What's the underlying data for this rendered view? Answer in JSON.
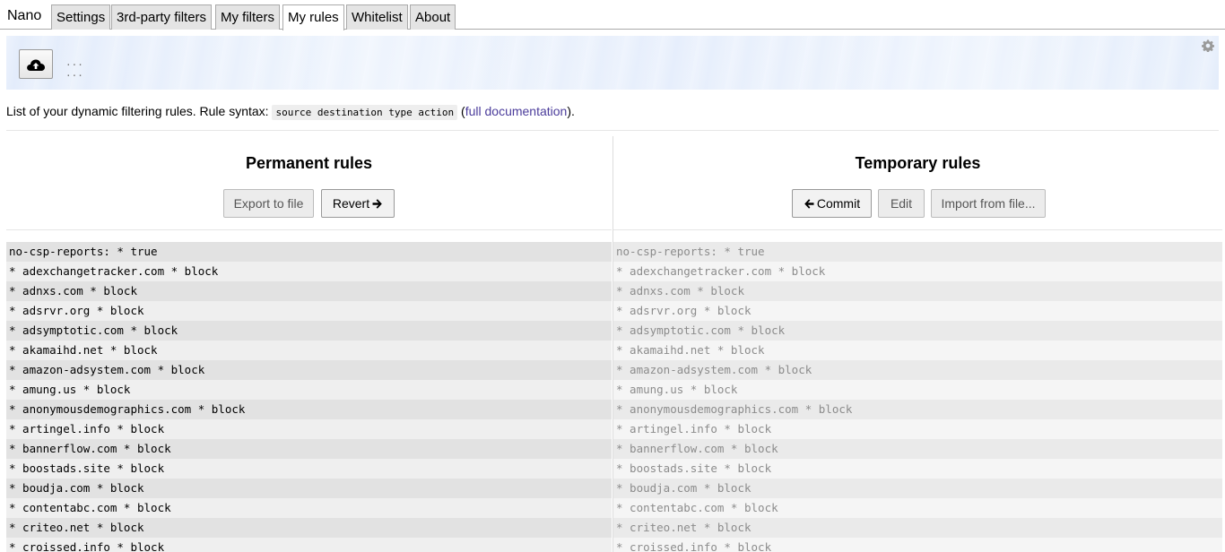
{
  "brand": "Nano",
  "tabs": [
    {
      "label": "Settings",
      "active": false
    },
    {
      "label": "3rd-party filters",
      "active": false
    },
    {
      "label": "My filters",
      "active": false
    },
    {
      "label": "My rules",
      "active": true
    },
    {
      "label": "Whitelist",
      "active": false
    },
    {
      "label": "About",
      "active": false
    }
  ],
  "cloud": {
    "icon": "cloud-upload-icon",
    "line1": "...",
    "line2": "...",
    "settings_icon": "gear-icon"
  },
  "description": {
    "text_before": "List of your dynamic filtering rules. Rule syntax: ",
    "syntax": "source destination type action",
    "paren_open": " (",
    "link_text": "full documentation",
    "paren_close": ")."
  },
  "permanent": {
    "title": "Permanent rules",
    "export_label": "Export to file",
    "revert_label": "Revert",
    "revert_icon": "arrow-right-icon"
  },
  "temporary": {
    "title": "Temporary rules",
    "commit_label": "Commit",
    "commit_icon": "arrow-left-icon",
    "edit_label": "Edit",
    "import_label": "Import from file..."
  },
  "rules": [
    "no-csp-reports: * true",
    "* adexchangetracker.com * block",
    "* adnxs.com * block",
    "* adsrvr.org * block",
    "* adsymptotic.com * block",
    "* akamaihd.net * block",
    "* amazon-adsystem.com * block",
    "* amung.us * block",
    "* anonymousdemographics.com * block",
    "* artingel.info * block",
    "* bannerflow.com * block",
    "* boostads.site * block",
    "* boudja.com * block",
    "* contentabc.com * block",
    "* criteo.net * block",
    "* croissed.info * block"
  ]
}
